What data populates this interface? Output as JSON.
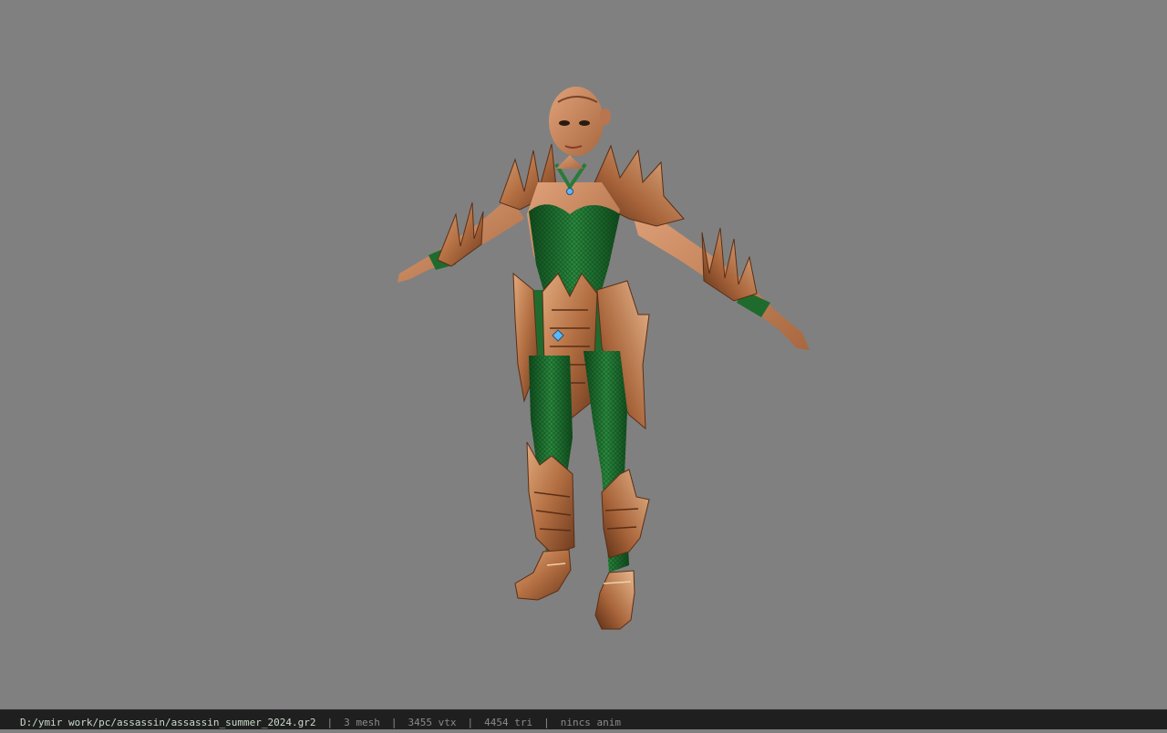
{
  "viewer": {
    "background_color": "#808080",
    "model_name": "assassin female character in green mesh bodysuit with bronze spiked armor, T-pose"
  },
  "statusbar": {
    "file_path": "D:/ymir work/pc/assassin/assassin_summer_2024.gr2",
    "separator": "|",
    "mesh_count": "3 mesh",
    "vertex_count": "3455 vtx",
    "triangle_count": "4454 tri",
    "anim_status": "nincs anim"
  },
  "colors": {
    "armor_bronze": "#b8764a",
    "suit_green": "#1f6b2e",
    "skin": "#c98a5e",
    "statusbar_bg": "#1f1f1f",
    "path_text": "#c8dcc8"
  }
}
